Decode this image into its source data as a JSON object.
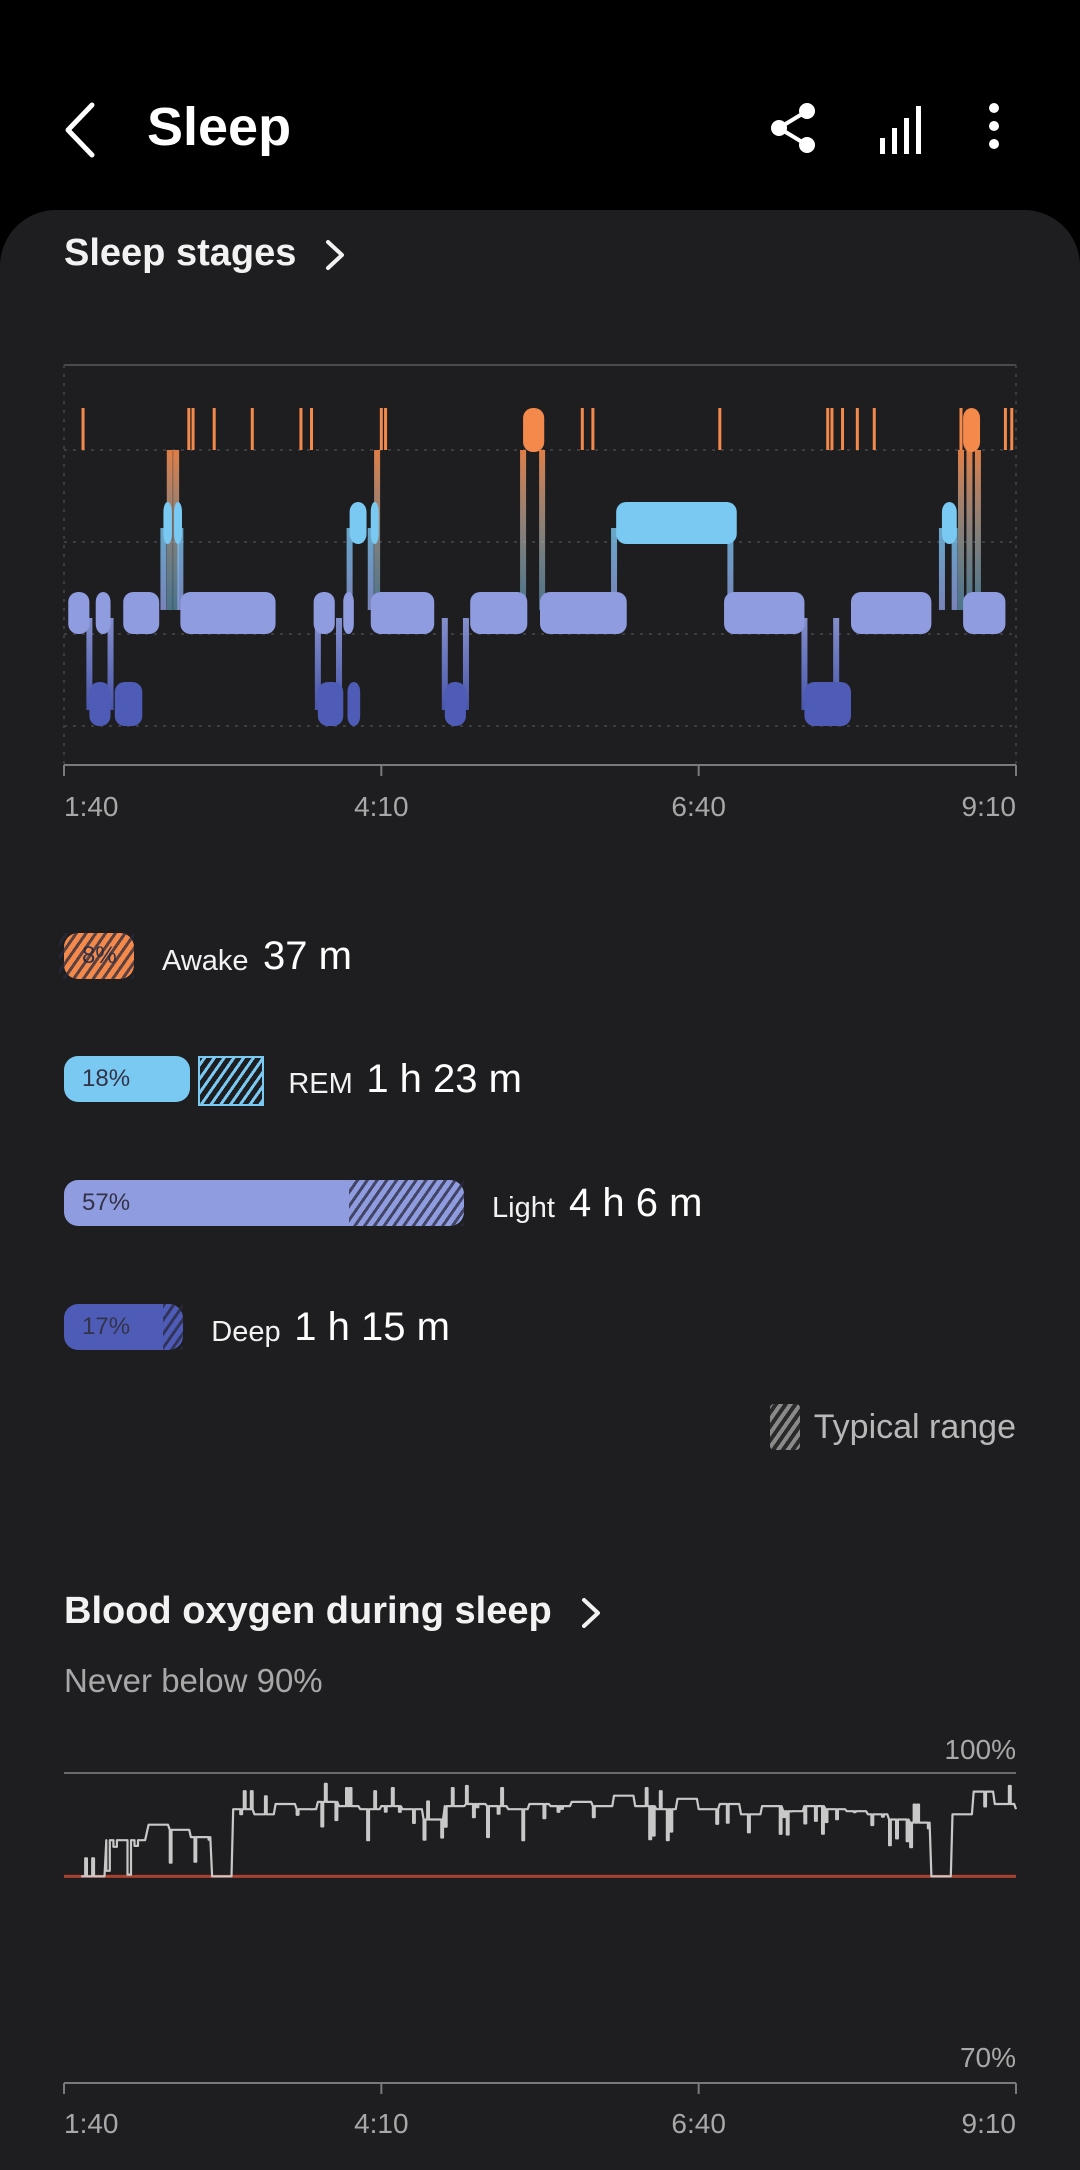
{
  "app_bar": {
    "title": "Sleep",
    "icons": [
      "back-icon",
      "share-icon",
      "signal-bars-icon",
      "more-options-icon"
    ]
  },
  "sleep_stages": {
    "title": "Sleep stages",
    "time_labels": [
      "1:40",
      "4:10",
      "6:40",
      "9:10"
    ],
    "colors": {
      "awake": "#f4894c",
      "rem": "#79c9f2",
      "light": "#8f9ce0",
      "deep": "#4e5cb8"
    },
    "stages": [
      {
        "key": "awake",
        "name": "Awake",
        "duration": "37 m",
        "percent": "8%",
        "percent_value": 8
      },
      {
        "key": "rem",
        "name": "REM",
        "duration": "1 h 23 m",
        "percent": "18%",
        "percent_value": 18
      },
      {
        "key": "light",
        "name": "Light",
        "duration": "4 h 6 m",
        "percent": "57%",
        "percent_value": 57
      },
      {
        "key": "deep",
        "name": "Deep",
        "duration": "1 h 15 m",
        "percent": "17%",
        "percent_value": 17
      }
    ],
    "typical_range_label": "Typical range"
  },
  "blood_oxygen": {
    "title": "Blood oxygen during sleep",
    "subtitle": "Never below 90%",
    "y_max_label": "100%",
    "y_min_label": "70%",
    "time_labels": [
      "1:40",
      "4:10",
      "6:40",
      "9:10"
    ],
    "line_color": "#c8c8c8",
    "threshold_color": "#a8412f"
  },
  "chart_data": [
    {
      "type": "bar",
      "title": "Sleep stages",
      "categories": [
        "Awake",
        "REM",
        "Light",
        "Deep"
      ],
      "values": [
        8,
        18,
        57,
        17
      ],
      "value_unit": "%",
      "x_ticks": [
        "1:40",
        "4:10",
        "6:40",
        "9:10"
      ],
      "x_range": [
        "1:40",
        "9:10"
      ]
    },
    {
      "type": "line",
      "title": "Blood oxygen during sleep",
      "x_ticks": [
        "1:40",
        "4:10",
        "6:40",
        "9:10"
      ],
      "x_range": [
        "1:40",
        "9:10"
      ],
      "ylim": [
        70,
        100
      ],
      "y_tick_labels": [
        "100%",
        "70%"
      ],
      "threshold": 90,
      "series": [
        {
          "x": [
            "1:50",
            "2:00",
            "2:20",
            "2:30",
            "2:40",
            "2:50",
            "3:00",
            "3:10",
            "3:20",
            "3:30",
            "3:40",
            "3:50",
            "4:00",
            "4:10",
            "4:20",
            "4:30",
            "4:40",
            "4:50",
            "5:00",
            "5:10",
            "5:20",
            "5:30",
            "5:40",
            "5:50",
            "6:00",
            "6:10",
            "6:20",
            "6:30",
            "6:40",
            "6:50",
            "7:00",
            "7:10",
            "7:20",
            "7:30",
            "7:40",
            "7:50",
            "8:00",
            "8:10",
            "8:20",
            "8:30",
            "8:40",
            "8:50",
            "9:00",
            "9:10"
          ],
          "y": [
            90,
            93.5,
            95,
            94.5,
            93.8,
            90,
            96.5,
            96,
            97,
            96.5,
            97.2,
            96.8,
            96.5,
            96.8,
            96.5,
            95.5,
            96.8,
            97,
            96.8,
            96.5,
            97,
            96.8,
            97.2,
            96.8,
            97.8,
            96.8,
            96.5,
            97.5,
            96.5,
            97,
            96,
            96.8,
            96.3,
            96.8,
            96.5,
            96.3,
            96,
            95.5,
            95.2,
            90,
            96,
            98.2,
            97,
            96.5
          ]
        }
      ]
    }
  ]
}
